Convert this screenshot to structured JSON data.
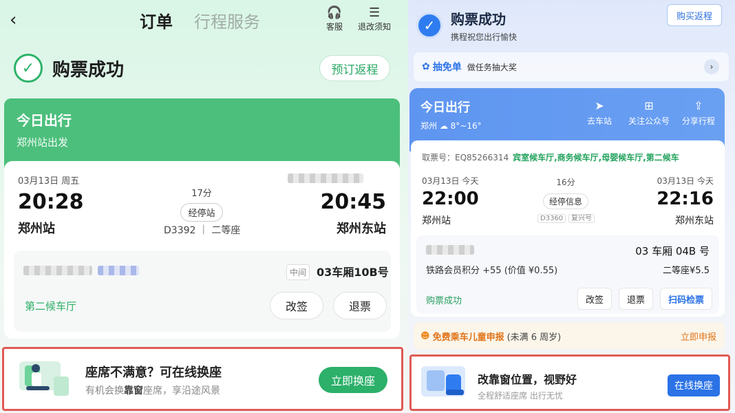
{
  "left": {
    "nav": {
      "back_icon": "‹",
      "tab_order": "订单",
      "tab_service": "行程服务",
      "service_label": "客服",
      "notice_label": "退改须知"
    },
    "success": {
      "check": "✓",
      "title": "购票成功",
      "return_button": "预订返程"
    },
    "today": {
      "title": "今日出行",
      "subtitle": "郑州站出发"
    },
    "trip": {
      "date": "03月13日 周五",
      "depart_time": "20:28",
      "arrive_time": "20:45",
      "from": "郑州站",
      "to": "郑州东站",
      "duration": "17分",
      "stop_info": "经停站",
      "train": "D3392",
      "seat_class": "二等座"
    },
    "seat": {
      "position": "中间",
      "car_seat": "03车厢10B号",
      "waiting_hall": "第二候车厅",
      "change_label": "改签",
      "refund_label": "退票"
    },
    "promo": {
      "title": "座席不满意？可在线换座",
      "desc_prefix": "有机会换",
      "desc_bold": "靠窗",
      "desc_suffix": "座席，享沿途风景",
      "button": "立即换座"
    }
  },
  "right": {
    "success": {
      "check": "✓",
      "title": "购票成功",
      "subtitle": "携程祝您出行愉快",
      "return_button": "购买返程"
    },
    "lottery": {
      "name": "抽免单",
      "desc": "做任务抽大奖"
    },
    "today": {
      "title": "今日出行",
      "weather": "郑州 ☁ 8°~16°",
      "go_station": "去车站",
      "follow": "关注公众号",
      "share": "分享行程"
    },
    "trip": {
      "ticket_code_label": "取票号：EQ85266314",
      "halls": "宾室候车厅,商务候车厅,母婴候车厅,第二候车",
      "depart_date": "03月13日  今天",
      "arrive_date": "03月13日  今天",
      "depart_time": "22:00",
      "arrive_time": "22:16",
      "from": "郑州站",
      "to": "郑州东站",
      "duration": "16分",
      "stop_info": "经停信息",
      "train": "D3360",
      "train_type": "复兴号"
    },
    "seat": {
      "car_seat": "03 车厢 04B 号",
      "points": "铁路会员积分 +55 (价值 ¥0.55)",
      "price": "二等座¥5.5",
      "status": "购票成功",
      "change": "改签",
      "refund": "退票",
      "scan": "扫码检票"
    },
    "child": {
      "title": "免费乘车儿童申报",
      "note": "(未满 6 周岁)",
      "action": "立即申报"
    },
    "promo": {
      "title": "改靠窗位置，视野好",
      "desc": "全程舒适座席 出行无忧",
      "button": "在线换座"
    }
  },
  "colors": {
    "green": "#2cb06a",
    "blue": "#2a72e6",
    "highlight": "#e05a55"
  }
}
